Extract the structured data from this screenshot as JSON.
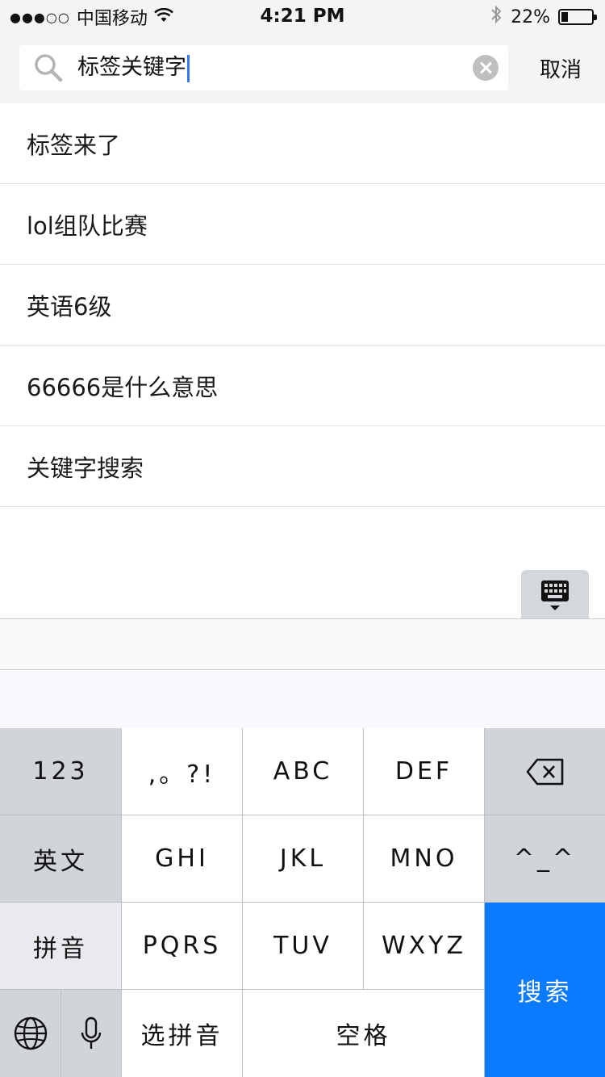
{
  "status_bar": {
    "signal": "●●●○○",
    "carrier": "中国移动",
    "time": "4:21 PM",
    "battery": "22%",
    "battery_level": 0.22,
    "wifi_icon": "wifi-icon",
    "bluetooth_icon": "bluetooth-icon"
  },
  "search": {
    "value": "标签关键字",
    "cancel_label": "取消"
  },
  "suggestions": [
    "标签来了",
    "lol组队比赛",
    "英语6级",
    "66666是什么意思",
    "关键字搜索"
  ],
  "keyboard": {
    "keys": {
      "k123": "123",
      "punct": ",。?!",
      "abc": "ABC",
      "def": "DEF",
      "english": "英文",
      "ghi": "GHI",
      "jkl": "JKL",
      "mno": "MNO",
      "emoticon": "^_^",
      "pinyin": "拼音",
      "pqrs": "PQRS",
      "tuv": "TUV",
      "wxyz": "WXYZ",
      "search": "搜索",
      "choose_pinyin": "选拼音",
      "space": "空格"
    },
    "accent_color": "#0a7bff"
  }
}
